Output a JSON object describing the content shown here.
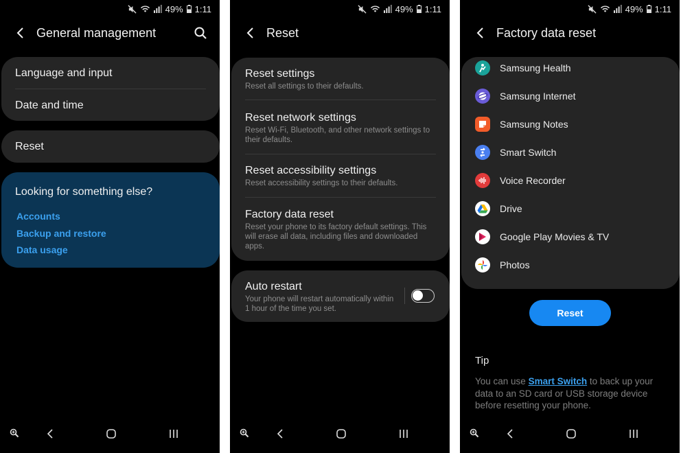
{
  "status": {
    "battery": "49%",
    "time": "1:11"
  },
  "screen1": {
    "title": "General management",
    "card1": {
      "items": [
        "Language and input",
        "Date and time"
      ]
    },
    "card2": {
      "item": "Reset"
    },
    "help": {
      "heading": "Looking for something else?",
      "links": [
        "Accounts",
        "Backup and restore",
        "Data usage"
      ]
    }
  },
  "screen2": {
    "title": "Reset",
    "items": [
      {
        "title": "Reset settings",
        "sub": "Reset all settings to their defaults."
      },
      {
        "title": "Reset network settings",
        "sub": "Reset Wi-Fi, Bluetooth, and other network settings to their defaults."
      },
      {
        "title": "Reset accessibility settings",
        "sub": "Reset accessibility settings to their defaults."
      },
      {
        "title": "Factory data reset",
        "sub": "Reset your phone to its factory default settings. This will erase all data, including files and downloaded apps."
      }
    ],
    "auto_restart": {
      "title": "Auto restart",
      "sub": "Your phone will restart automatically within 1 hour of the time you set.",
      "enabled": false
    }
  },
  "screen3": {
    "title": "Factory data reset",
    "apps": [
      {
        "name": "Samsung Health",
        "icon": "samsung-health-icon",
        "color": "#1aa39a"
      },
      {
        "name": "Samsung Internet",
        "icon": "samsung-internet-icon",
        "color": "#6a5cd8"
      },
      {
        "name": "Samsung Notes",
        "icon": "samsung-notes-icon",
        "color": "#f25c2a"
      },
      {
        "name": "Smart Switch",
        "icon": "smart-switch-icon",
        "color": "#4a7ff0"
      },
      {
        "name": "Voice Recorder",
        "icon": "voice-recorder-icon",
        "color": "#e23b3b"
      },
      {
        "name": "Drive",
        "icon": "google-drive-icon",
        "color": "#ffffff"
      },
      {
        "name": "Google Play Movies & TV",
        "icon": "play-movies-icon",
        "color": "#ffffff"
      },
      {
        "name": "Photos",
        "icon": "google-photos-icon",
        "color": "#ffffff"
      }
    ],
    "reset_button": "Reset",
    "tip": {
      "title": "Tip",
      "before": "You can use ",
      "link": "Smart Switch",
      "after": " to back up your data to an SD card or USB storage device before resetting your phone."
    }
  }
}
